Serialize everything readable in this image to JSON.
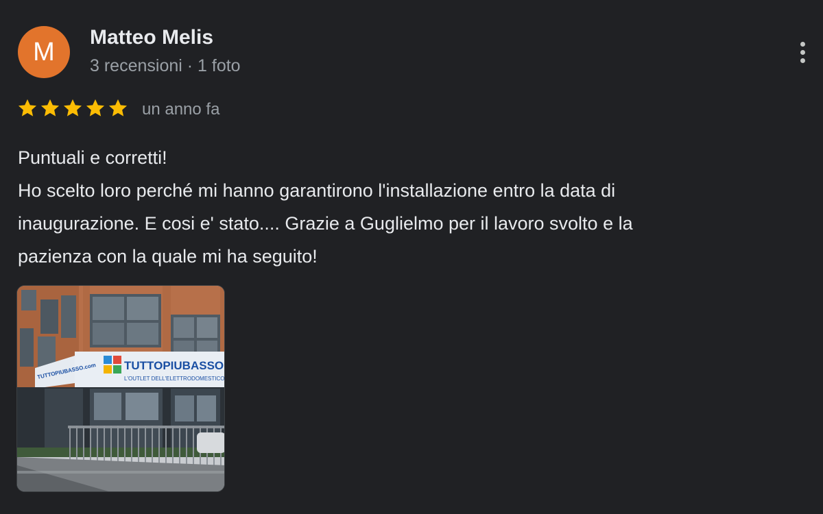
{
  "author": {
    "initial": "M",
    "name": "Matteo Melis",
    "meta": "3 recensioni · 1 foto",
    "avatar_color": "#e2742c"
  },
  "review": {
    "rating": 5,
    "max_rating": 5,
    "time": "un anno fa",
    "lines": [
      "Puntuali e corretti!",
      "Ho scelto loro perché mi hanno garantirono l'installazione entro la data di",
      "inaugurazione. E cosi e' stato.... Grazie a Guglielmo per il lavoro svolto e la",
      "pazienza con la quale mi ha seguito!"
    ]
  },
  "photo": {
    "sign_text": "TUTTOPIUBASSO.com",
    "sign_subtext": "L'OUTLET DELL'ELETTRODOMESTICO",
    "side_sign_text": "TUTTOPIUBASSO.com"
  },
  "colors": {
    "background": "#202124",
    "star": "#fbbc04",
    "primary_text": "#e8eaed",
    "secondary_text": "#9aa0a6"
  },
  "icons": {
    "more": "more-vert-icon",
    "star": "star-icon"
  }
}
